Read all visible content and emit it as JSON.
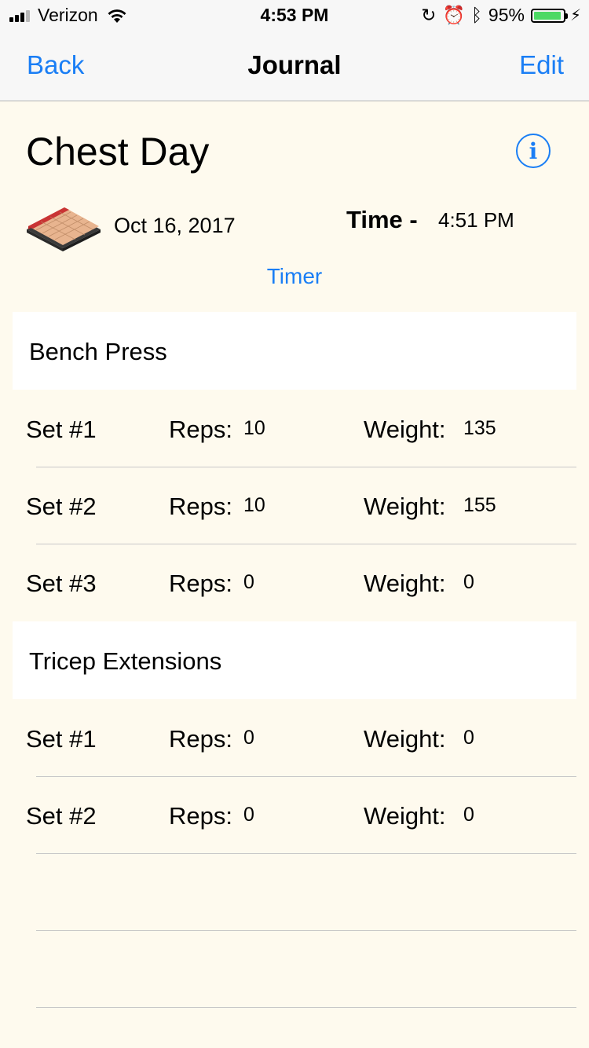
{
  "status_bar": {
    "carrier": "Verizon",
    "time": "4:53 PM",
    "battery_percent": "95%",
    "battery_level": 0.95
  },
  "nav": {
    "back_label": "Back",
    "title": "Journal",
    "edit_label": "Edit"
  },
  "workout": {
    "title": "Chest Day",
    "date": "Oct 16, 2017",
    "time_label": "Time -",
    "time_value": "4:51 PM",
    "timer_label": "Timer"
  },
  "exercises": [
    {
      "name": "Bench Press",
      "sets": [
        {
          "set": "Set #1",
          "reps_label": "Reps:",
          "reps": "10",
          "weight_label": "Weight:",
          "weight": "135"
        },
        {
          "set": "Set #2",
          "reps_label": "Reps:",
          "reps": "10",
          "weight_label": "Weight:",
          "weight": "155"
        },
        {
          "set": "Set #3",
          "reps_label": "Reps:",
          "reps": "0",
          "weight_label": "Weight:",
          "weight": "0"
        }
      ]
    },
    {
      "name": "Tricep Extensions",
      "sets": [
        {
          "set": "Set #1",
          "reps_label": "Reps:",
          "reps": "0",
          "weight_label": "Weight:",
          "weight": "0"
        },
        {
          "set": "Set #2",
          "reps_label": "Reps:",
          "reps": "0",
          "weight_label": "Weight:",
          "weight": "0"
        }
      ]
    }
  ],
  "colors": {
    "accent": "#1a7ef5",
    "background": "#fefaee",
    "battery": "#4cd964"
  },
  "icons": {
    "info": "info-circle-icon",
    "calendar": "calendar-icon"
  }
}
